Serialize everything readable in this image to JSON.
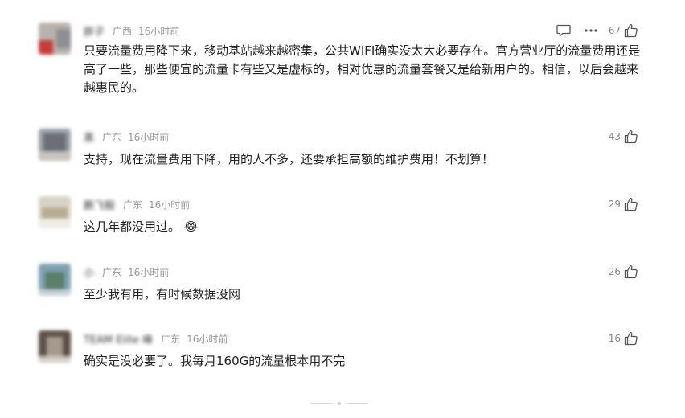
{
  "comments": [
    {
      "user": "胖子",
      "region": "广西",
      "time": "16小时前",
      "likes": "67",
      "text": "只要流量费用降下来，移动基站越来越密集，公共WIFI确实没太大必要存在。官方营业厅的流量费用还是高了一些，那些便宜的流量卡有些又是虚标的，相对优惠的流量套餐又是给新用户的。相信，以后会越来越惠民的。",
      "avatar_colors": [
        "#b9b1ae",
        "#c93a3a",
        "#8f8f93"
      ]
    },
    {
      "user": "黑",
      "region": "广东",
      "time": "16小时前",
      "likes": "43",
      "text": "支持，现在流量费用下降，用的人不多，还要承担高额的维护费用！不划算！",
      "avatar_colors": [
        "#9ba0a8",
        "#6b6f74",
        "#c7c3bd"
      ]
    },
    {
      "user": "鹏飞毅",
      "region": "广东",
      "time": "16小时前",
      "likes": "29",
      "text": "这几年都没用过。",
      "emoji": "😂",
      "avatar_colors": [
        "#d8d3c7",
        "#b7ad93",
        "#efece6"
      ]
    },
    {
      "user": "小",
      "region": "广东",
      "time": "16小时前",
      "likes": "26",
      "text": "至少我有用，有时候数据没网",
      "avatar_colors": [
        "#7fa2b3",
        "#5a7f6a",
        "#c6d3d8"
      ]
    },
    {
      "user": "TEAM Elite 峰",
      "region": "广东",
      "time": "16小时前",
      "likes": "16",
      "text": "确实是没必要了。我每月160G的流量根本用不完",
      "avatar_colors": [
        "#5b5048",
        "#a69a8c",
        "#d5cfc8"
      ]
    }
  ]
}
